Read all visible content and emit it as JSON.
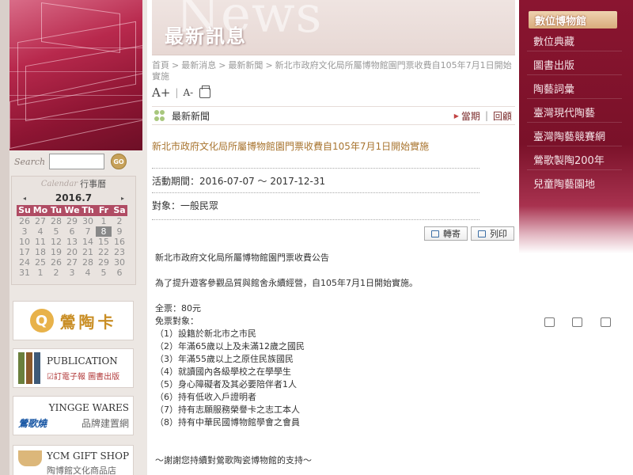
{
  "header": {
    "bg_word": "News",
    "title": "最新訊息"
  },
  "breadcrumb": {
    "items": [
      "首頁",
      "最新消息",
      "最新新聞",
      "新北市政府文化局所屬博物館園門票收費自105年7月1日開始實施"
    ],
    "separator": ">"
  },
  "tools": {
    "font_larger": "A+",
    "font_smaller": "A-"
  },
  "section": {
    "title": "最新新聞",
    "link_current": "當期",
    "link_review": "回顧"
  },
  "article": {
    "title": "新北市政府文化局所屬博物館園門票收費自105年7月1日開始實施",
    "period": "活動期間：2016-07-07 ～ 2017-12-31",
    "audience": "對象：一般民眾",
    "share_label": "轉寄",
    "print_label": "列印",
    "body": [
      "新北市政府文化局所屬博物館園門票收費公告",
      "",
      "為了提升遊客參觀品質與館舍永續經營，自105年7月1日開始實施。",
      "",
      "全票：80元",
      "免票對象：",
      "（1）設籍於新北市之市民",
      "（2）年滿65歲以上及未滿12歲之國民",
      "（3）年滿55歲以上之原住民族國民",
      "（4）就讀國內各級學校之在學學生",
      "（5）身心障礙者及其必要陪伴者1人",
      "（6）持有低收入戶證明者",
      "（7）持有志願服務榮譽卡之志工本人",
      "（8）持有中華民國博物館學會之會員",
      "",
      "",
      "～謝謝您持續對鶯歌陶瓷博物館的支持～"
    ]
  },
  "search": {
    "label": "Search",
    "value": "",
    "go_label": "GO"
  },
  "calendar": {
    "label_en": "Calendar",
    "label_zh": "行事曆",
    "month": "2016.7",
    "prev": "◂",
    "next": "▸",
    "dow": [
      "Su",
      "Mo",
      "Tu",
      "We",
      "Th",
      "Fr",
      "Sa"
    ],
    "days": [
      "26",
      "27",
      "28",
      "29",
      "30",
      "1",
      "2",
      "3",
      "4",
      "5",
      "6",
      "7",
      "8",
      "9",
      "10",
      "11",
      "12",
      "13",
      "14",
      "15",
      "16",
      "17",
      "18",
      "19",
      "20",
      "21",
      "22",
      "23",
      "24",
      "25",
      "26",
      "27",
      "28",
      "29",
      "30",
      "31",
      "1",
      "2",
      "3",
      "4",
      "5",
      "6"
    ],
    "today": "8"
  },
  "promos": {
    "card": "鶯陶卡",
    "pub_en": "PUBLICATION",
    "pub_zh": "☑訂電子報 圖書出版",
    "wares_en": "YINGGE WARES",
    "wares_brand": "鶯歌燒",
    "wares_zh": "品牌建置網",
    "gift_en": "YCM GIFT SHOP",
    "gift_zh": "陶博館文化商品店"
  },
  "nav": {
    "heading": "數位博物館",
    "items": [
      "數位典藏",
      "圖書出版",
      "陶藝詞彙",
      "臺灣現代陶藝",
      "臺灣陶藝競賽網",
      "鶯歌製陶200年",
      "兒童陶藝園地"
    ]
  },
  "colors": {
    "brand": "#8a1530",
    "accent": "#a8742f",
    "link": "#7a2a2a"
  }
}
